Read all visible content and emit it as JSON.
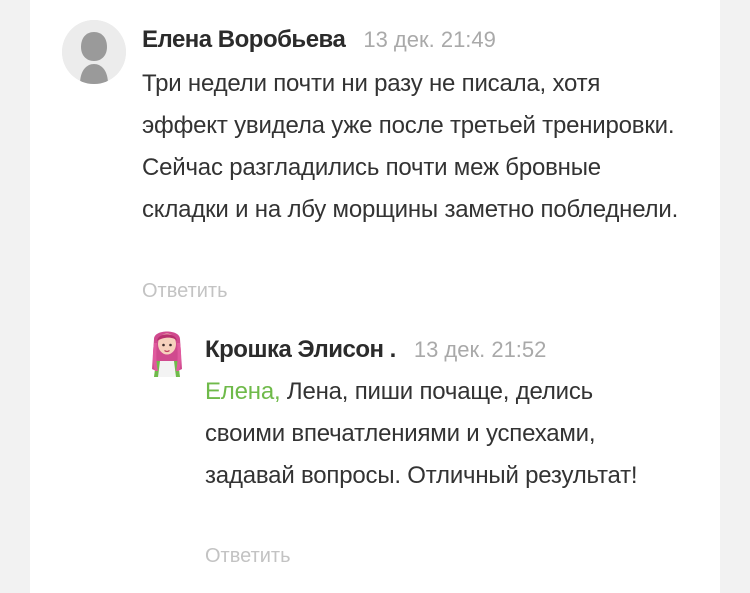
{
  "comments": [
    {
      "author": "Елена Воробьева",
      "date": "13 дек. 21:49",
      "text": "Три недели почти ни разу не писала, хотя эффект увидела уже после третьей тренировки. Сейчас разгладились почти меж бровные складки и на лбу морщины заметно побледнели.",
      "reply_label": "Ответить"
    },
    {
      "author": "Крошка Элисон .",
      "date": "13 дек. 21:52",
      "mention": "Елена,",
      "text": " Лена, пиши почаще, делись своими впечатлениями и успехами, задавай вопросы. Отличный результат!",
      "reply_label": "Ответить"
    }
  ],
  "colors": {
    "mention": "#6fba4a",
    "date": "#a9a9a9",
    "reply": "#c3c3c3",
    "text": "#333333"
  }
}
